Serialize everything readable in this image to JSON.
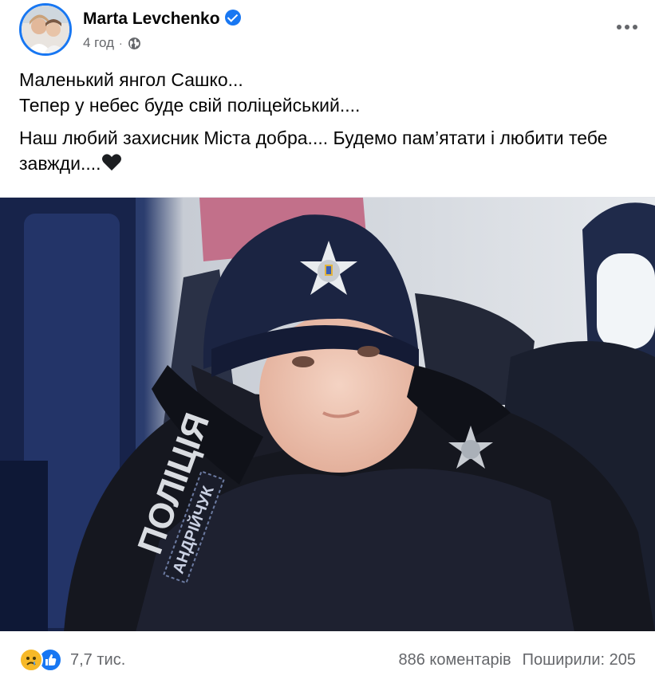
{
  "post": {
    "author": "Marta Levchenko",
    "time": "4 год",
    "separator": "·",
    "paragraphs": [
      "Маленький янгол Сашко...",
      "Тепер у небес буде свій поліцейський....",
      "Наш любий захисник Міста добра.... Будемо пам’ятати і любити тебе завжди...."
    ],
    "photo_text": {
      "patch": "ПОЛІЦІЯ",
      "name_tag": "АНДРІЙЧУК"
    }
  },
  "footer": {
    "reactions_count": "7,7 тис.",
    "comments": "886 коментарів",
    "shares": "Поширили: 205"
  },
  "colors": {
    "brand": "#1877f2",
    "secondary_text": "#65676b",
    "sad_reaction": "#f7b928"
  },
  "icons": [
    "verified-badge-icon",
    "globe-icon",
    "more-options-icon",
    "black-heart-icon",
    "sad-reaction-icon",
    "like-reaction-icon"
  ]
}
